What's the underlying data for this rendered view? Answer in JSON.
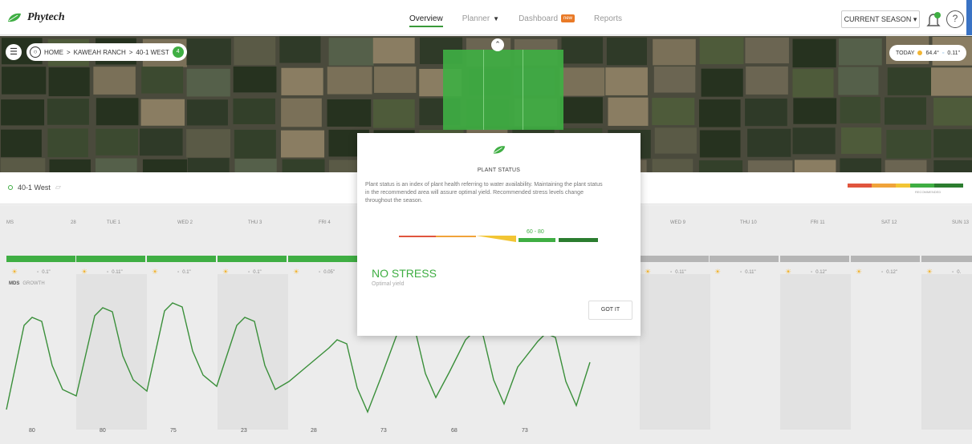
{
  "app": {
    "brand": "Phytech"
  },
  "nav": {
    "overview": "Overview",
    "planner": "Planner",
    "dashboard": "Dashboard",
    "dashboard_badge": "new",
    "reports": "Reports"
  },
  "season_button": "CURRENT SEASON ▾",
  "help_glyph": "?",
  "breadcrumb": {
    "home": "HOME",
    "ranch": "KAWEAH RANCH",
    "field": "40-1 WEST",
    "count": "4",
    "separator": ">"
  },
  "weather": {
    "label": "TODAY",
    "temp": "64.4°",
    "rain": "0.11\""
  },
  "field_row": {
    "name": "40-1 West",
    "legend_label": "RECOMMENDED"
  },
  "days": [
    {
      "label": "MS",
      "date": "28"
    },
    {
      "label": "TUE 1"
    },
    {
      "label": "WED 2"
    },
    {
      "label": "THU 3"
    },
    {
      "label": "FRI 4"
    },
    {
      "label": "WED 9"
    },
    {
      "label": "THU 10"
    },
    {
      "label": "FRI 11"
    },
    {
      "label": "SAT 12"
    },
    {
      "label": "SUN 13"
    }
  ],
  "weather_row": [
    {
      "rain": "0.1\""
    },
    {
      "rain": "0.11\""
    },
    {
      "rain": "0.1\""
    },
    {
      "rain": "0.1\""
    },
    {
      "rain": "0.05\""
    },
    {
      "rain": "0.11\""
    },
    {
      "rain": "0.11\""
    },
    {
      "rain": "0.12\""
    },
    {
      "rain": "0.12\""
    },
    {
      "rain": "0."
    }
  ],
  "chart_tabs": {
    "mds": "MDS",
    "growth": "GROWTH"
  },
  "bottom_values": [
    "80",
    "80",
    "75",
    "23",
    "28",
    "73",
    "68",
    "73"
  ],
  "modal": {
    "title": "PLANT STATUS",
    "description": "Plant status is an index of plant health referring to water availability. Maintaining the plant status in the recommended area will assure optimal yield. Recommended stress levels change throughout the season.",
    "range": "60 - 80",
    "status": "NO STRESS",
    "status_sub": "Optimal yield",
    "button": "GOT IT"
  },
  "colors": {
    "accent": "#3fae43",
    "red": "#e0553d",
    "orange": "#f0a33a",
    "yellow": "#f2c534",
    "dark_green": "#2b7d2f",
    "warning": "#e97a27"
  },
  "icons": [
    "leaf-icon",
    "bell-icon",
    "help-icon",
    "menu-icon",
    "globe-icon",
    "chevron-up-icon",
    "sun-icon",
    "rain-icon"
  ]
}
